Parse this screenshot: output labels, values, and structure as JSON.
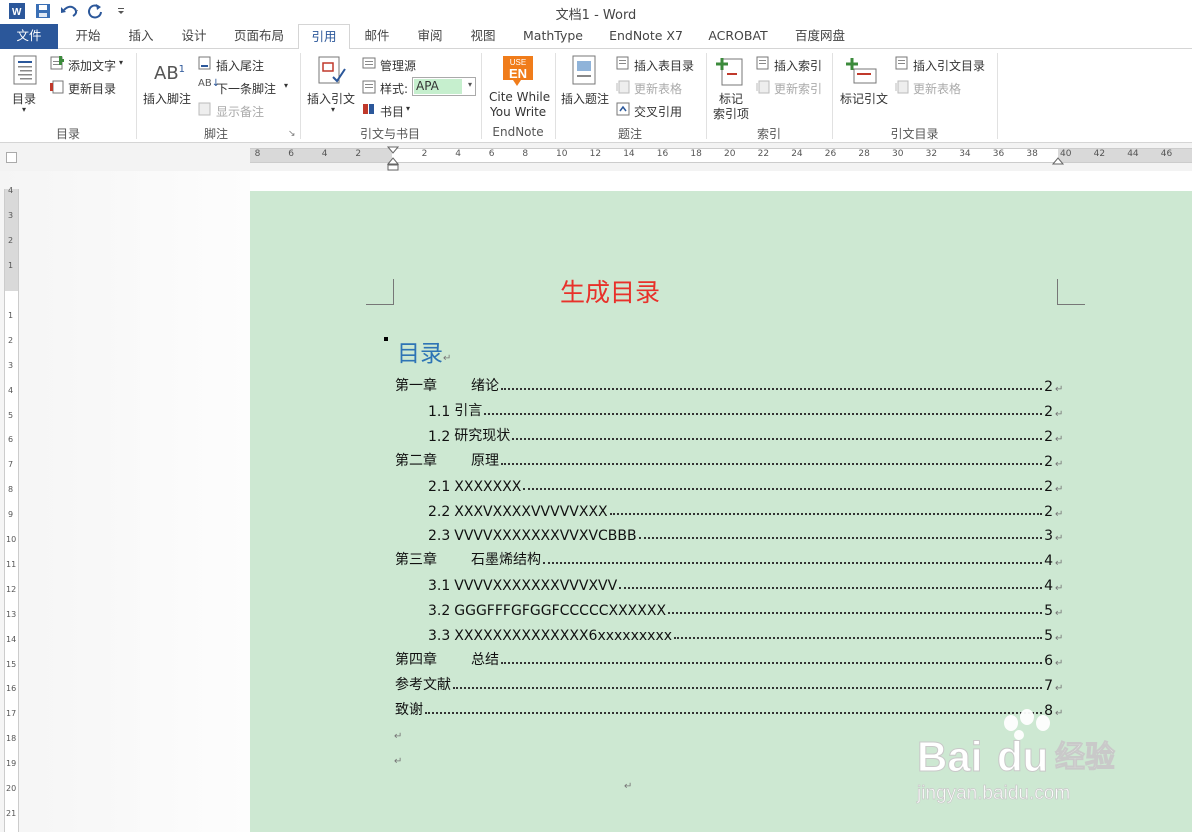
{
  "window": {
    "title": "文档1 - Word"
  },
  "tabs": [
    "文件",
    "开始",
    "插入",
    "设计",
    "页面布局",
    "引用",
    "邮件",
    "审阅",
    "视图",
    "MathType",
    "EndNote X7",
    "ACROBAT",
    "百度网盘"
  ],
  "ribbon": {
    "toc": {
      "big": "目录",
      "add_text": "添加文字",
      "update": "更新目录",
      "group": "目录"
    },
    "footnote": {
      "insert_footnote": "插入脚注",
      "ab": "AB",
      "sup": "1",
      "insert_endnote": "插入尾注",
      "next_footnote": "下一条脚注",
      "show_notes": "显示备注",
      "group": "脚注"
    },
    "citation": {
      "insert_citation": "插入引文",
      "manage": "管理源",
      "style_label": "样式:",
      "style_value": "APA",
      "biblio": "书目",
      "group": "引文与书目"
    },
    "endnote": {
      "use": "USE",
      "en": "EN",
      "cite1": "Cite While",
      "cite2": "You Write",
      "group": "EndNote"
    },
    "caption": {
      "insert_caption": "插入题注",
      "insert_tof": "插入表目录",
      "update_table": "更新表格",
      "cross_ref": "交叉引用",
      "group": "题注"
    },
    "index": {
      "mark1": "标记",
      "mark2": "索引项",
      "insert_index": "插入索引",
      "update_index": "更新索引",
      "group": "索引"
    },
    "toa": {
      "mark_citation": "标记引文",
      "insert_toa": "插入引文目录",
      "update_table": "更新表格",
      "group": "引文目录"
    }
  },
  "ruler": {
    "h_left": [
      "8",
      "6",
      "4",
      "2"
    ],
    "h_right": [
      "2",
      "4",
      "6",
      "8",
      "10",
      "12",
      "14",
      "16",
      "18",
      "20",
      "22",
      "24",
      "26",
      "28",
      "30",
      "32",
      "34",
      "36",
      "38",
      "40",
      "42",
      "44",
      "46"
    ],
    "v_top": [
      "4",
      "3",
      "2",
      "1"
    ],
    "v_body": [
      "1",
      "2",
      "3",
      "4",
      "5",
      "6",
      "7",
      "8",
      "9",
      "10",
      "11",
      "12",
      "13",
      "14",
      "15",
      "16",
      "17",
      "18",
      "19",
      "20",
      "21"
    ]
  },
  "document": {
    "title": "生成目录",
    "toc_heading": "目录",
    "paragraph_mark": "↵",
    "entries": [
      {
        "num": "第一章",
        "title": "绪论",
        "page": "2",
        "level": 1
      },
      {
        "num": "1.1",
        "title": "引言",
        "page": "2",
        "level": 2
      },
      {
        "num": "1.2",
        "title": "研究现状",
        "page": "2",
        "level": 2
      },
      {
        "num": "第二章",
        "title": "原理",
        "page": "2",
        "level": 1
      },
      {
        "num": "2.1",
        "title": "XXXXXXX",
        "page": "2",
        "level": 2
      },
      {
        "num": "2.2",
        "title": "XXXVXXXXVVVVVXXX",
        "page": "2",
        "level": 2
      },
      {
        "num": "2.3",
        "title": "VVVVXXXXXXXVVXVCBBB",
        "page": "3",
        "level": 2
      },
      {
        "num": "第三章",
        "title": "石墨烯结构",
        "page": "4",
        "level": 1
      },
      {
        "num": "3.1",
        "title": "VVVVXXXXXXXVVVXVV",
        "page": "4",
        "level": 2
      },
      {
        "num": "3.2",
        "title": "GGGFFFGFGGFCCCCCXXXXXX",
        "page": "5",
        "level": 2
      },
      {
        "num": "3.3",
        "title": "XXXXXXXXXXXXXX6xxxxxxxxx",
        "page": "5",
        "level": 2
      },
      {
        "num": "第四章",
        "title": "总结",
        "page": "6",
        "level": 1
      },
      {
        "num": "",
        "title": "参考文献",
        "page": "7",
        "level": 1
      },
      {
        "num": "",
        "title": "致谢",
        "page": "8",
        "level": 1
      }
    ]
  },
  "watermark": {
    "brand": "Bai",
    "brand2": "du",
    "cn": "经验",
    "url": "jingyan.baidu.com"
  },
  "colors": {
    "file_tab": "#2b579a",
    "page_bg": "#cde8d2",
    "title_red": "#e8312a",
    "heading_blue": "#2e74b5"
  }
}
